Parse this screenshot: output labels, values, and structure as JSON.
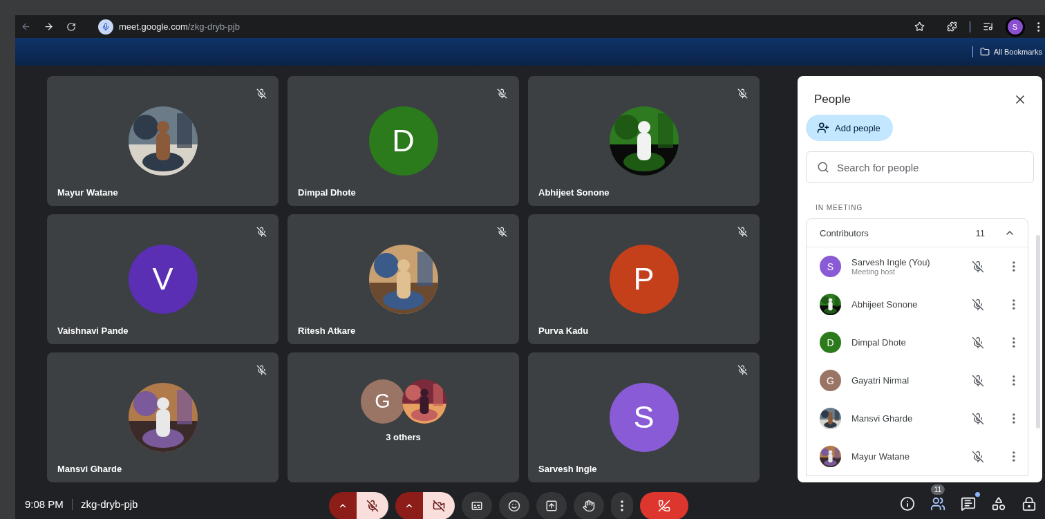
{
  "browser": {
    "url_host": "meet.google.com",
    "url_path": "/zkg-dryb-pjb",
    "profile_initial": "S",
    "bookmarks_label": "All Bookmarks"
  },
  "tiles": [
    {
      "kind": "single",
      "name": "Mayur Watane",
      "muted": true,
      "avatar": {
        "kind": "picture"
      }
    },
    {
      "kind": "single",
      "name": "Dimpal Dhote",
      "muted": true,
      "avatar": {
        "kind": "letter",
        "letter": "D",
        "color": "#2b7a1c"
      }
    },
    {
      "kind": "single",
      "name": "Abhijeet Sonone",
      "muted": true,
      "avatar": {
        "kind": "picture"
      }
    },
    {
      "kind": "single",
      "name": "Vaishnavi Pande",
      "muted": true,
      "avatar": {
        "kind": "letter",
        "letter": "V",
        "color": "#5a2fb3"
      }
    },
    {
      "kind": "single",
      "name": "Ritesh Atkare",
      "muted": true,
      "avatar": {
        "kind": "picture"
      }
    },
    {
      "kind": "single",
      "name": "Purva Kadu",
      "muted": true,
      "avatar": {
        "kind": "letter",
        "letter": "P",
        "color": "#c4401b"
      }
    },
    {
      "kind": "single",
      "name": "Mansvi Gharde",
      "muted": true,
      "avatar": {
        "kind": "picture"
      }
    },
    {
      "kind": "group",
      "name": "3 others",
      "muted": false,
      "avatars": [
        {
          "kind": "letter",
          "letter": "G",
          "color": "#9a7565"
        },
        {
          "kind": "picture"
        }
      ]
    },
    {
      "kind": "single",
      "name": "Sarvesh Ingle",
      "muted": true,
      "avatar": {
        "kind": "letter",
        "letter": "S",
        "color": "#8a5bd6"
      }
    }
  ],
  "people_panel": {
    "title": "People",
    "add_button": "Add people",
    "search_placeholder": "Search for people",
    "section_label": "IN MEETING",
    "group": {
      "label": "Contributors",
      "count": "11",
      "expanded": true
    },
    "participants": [
      {
        "name": "Sarvesh Ingle (You)",
        "subtitle": "Meeting host",
        "muted": true,
        "avatar": {
          "kind": "letter",
          "letter": "S",
          "color": "#8a5bd6"
        }
      },
      {
        "name": "Abhijeet Sonone",
        "muted": true,
        "avatar": {
          "kind": "picture"
        }
      },
      {
        "name": "Dimpal Dhote",
        "muted": true,
        "avatar": {
          "kind": "letter",
          "letter": "D",
          "color": "#2b7a1c"
        }
      },
      {
        "name": "Gayatri Nirmal",
        "muted": true,
        "avatar": {
          "kind": "letter",
          "letter": "G",
          "color": "#9a7565"
        }
      },
      {
        "name": "Mansvi Gharde",
        "muted": true,
        "avatar": {
          "kind": "picture"
        }
      },
      {
        "name": "Mayur Watane",
        "muted": true,
        "avatar": {
          "kind": "picture"
        }
      }
    ]
  },
  "bottom_bar": {
    "time": "9:08 PM",
    "meeting_code": "zkg-dryb-pjb",
    "mic_on": false,
    "camera_on": false,
    "people_count": "11",
    "chat_unread": true
  }
}
